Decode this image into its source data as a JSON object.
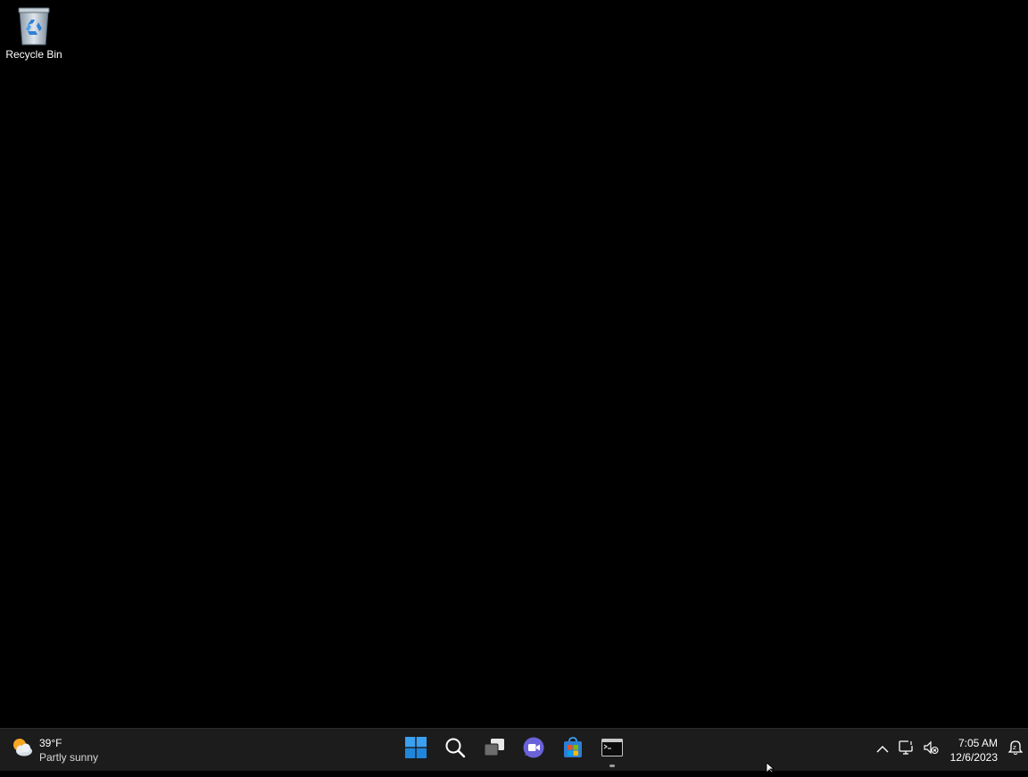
{
  "desktop": {
    "icons": [
      {
        "label": "Recycle Bin",
        "icon": "recycle-bin-icon"
      }
    ]
  },
  "taskbar": {
    "weather": {
      "temperature": "39°F",
      "condition": "Partly sunny",
      "icon": "partly-sunny-icon"
    },
    "apps": [
      {
        "name": "start",
        "icon": "windows-start-icon"
      },
      {
        "name": "search",
        "icon": "search-icon"
      },
      {
        "name": "task-view",
        "icon": "task-view-icon"
      },
      {
        "name": "chat",
        "icon": "chat-video-icon"
      },
      {
        "name": "store",
        "icon": "store-icon"
      },
      {
        "name": "terminal",
        "icon": "terminal-icon",
        "running": true
      }
    ],
    "tray": {
      "overflow_icon": "chevron-up-icon",
      "network_icon": "network-icon",
      "volume_icon": "volume-muted-icon",
      "notification_icon": "notification-bell-icon",
      "time": "7:05 AM",
      "date": "12/6/2023"
    }
  },
  "colors": {
    "desktop_bg": "#000000",
    "taskbar_bg": "#1c1c1c",
    "accent": "#0078d4"
  }
}
